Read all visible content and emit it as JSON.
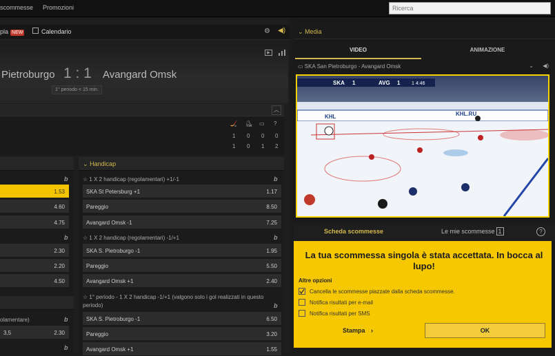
{
  "topnav": {
    "item1": "scommesse",
    "item2": "Promozioni",
    "search_placeholder": "Ricerca"
  },
  "subnav": {
    "item1": "pla",
    "new_badge": "NEW",
    "calendar": "Calendario"
  },
  "match": {
    "team_a": "Pietroburgo",
    "score": "1 : 1",
    "team_b": "Avangard Omsk",
    "period": "1° periodo < 15 min."
  },
  "stats": {
    "row1": [
      "1",
      "0",
      "0",
      "0"
    ],
    "row2": [
      "1",
      "0",
      "1",
      "2"
    ]
  },
  "left_col": {
    "rows_top": [
      {
        "odd": "1.53",
        "selected": true
      },
      {
        "odd": "4.60"
      },
      {
        "odd": "4.75"
      }
    ],
    "rows_mid": [
      {
        "odd": "2.30"
      },
      {
        "odd": "2.20"
      },
      {
        "odd": "4.50"
      }
    ],
    "label_bottom": "olamentare)",
    "row_last_label": "3,5",
    "row_last_odd": "2.30"
  },
  "handicap": {
    "title": "Handicap",
    "markets": [
      {
        "title": "1 X 2 handicap (regolamentari) +1/-1",
        "rows": [
          {
            "label": "SKA St Petersburg +1",
            "odd": "1.17"
          },
          {
            "label": "Pareggio",
            "odd": "8.50"
          },
          {
            "label": "Avangard Omsk -1",
            "odd": "7.25"
          }
        ]
      },
      {
        "title": "1 X 2 handicap (regolamentari) -1/+1",
        "rows": [
          {
            "label": "SKA S. Pietroburgo -1",
            "odd": "1.95"
          },
          {
            "label": "Pareggio",
            "odd": "5.50"
          },
          {
            "label": "Avangard Omsk +1",
            "odd": "2.40"
          }
        ]
      },
      {
        "title": "1° periodo - 1 X 2 handicap -1/+1 (valgono solo i gol realizzati in questo",
        "title2": "periodo)",
        "rows": [
          {
            "label": "SKA S. Pietroburgo -1",
            "odd": "6.50"
          },
          {
            "label": "Pareggio",
            "odd": "3.20"
          },
          {
            "label": "Avangard Omsk +1",
            "odd": "1.55"
          }
        ]
      }
    ]
  },
  "media": {
    "title": "Media",
    "tab_video": "VIDEO",
    "tab_animation": "ANIMAZIONE",
    "stream": "SKA San Pietroburgo - Avangard Omsk",
    "scorebug": {
      "home": "SKA",
      "home_score": "1",
      "away": "AVG",
      "away_score": "1",
      "clock": "1 4:46"
    }
  },
  "betslip": {
    "tab1": "Scheda scommesse",
    "tab2": "Le mie scommesse",
    "count": "1",
    "accepted": "La tua scommessa singola è stata accettata. In bocca al lupo!",
    "options_title": "Altre opzioni",
    "options": [
      {
        "label": "Cancella le scommesse piazzate dalla scheda scommesse.",
        "checked": true
      },
      {
        "label": "Notifica risultati per e-mail",
        "checked": false
      },
      {
        "label": "Notifica risultati per SMS",
        "checked": false
      }
    ],
    "stampa": "Stampa",
    "ok": "OK"
  },
  "colors": {
    "accent": "#f4c400",
    "section_title": "#d6b94e",
    "panel": "#f6c801"
  }
}
